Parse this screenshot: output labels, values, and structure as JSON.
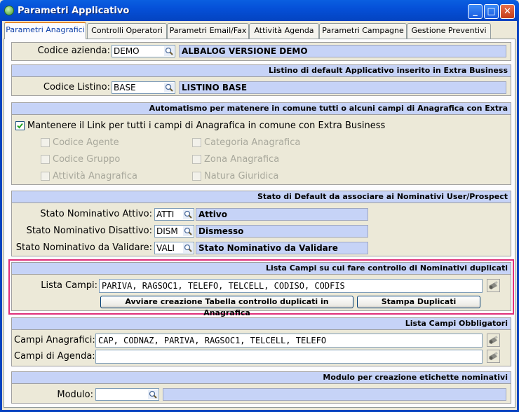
{
  "window": {
    "title": "Parametri Applicativo",
    "min": "_",
    "max": "□",
    "close": "✕"
  },
  "tabs": [
    "Parametri Anagrafici",
    "Controlli Operatori",
    "Parametri Email/Fax",
    "Attività Agenda",
    "Parametri Campagne",
    "Gestione Preventivi"
  ],
  "azienda": {
    "label": "Codice azienda:",
    "code": "DEMO",
    "desc": "ALBALOG VERSIONE DEMO"
  },
  "listino": {
    "header": "Listino di default Applicativo inserito in Extra Business",
    "label": "Codice Listino:",
    "code": "BASE",
    "desc": "LISTINO BASE"
  },
  "automatismo": {
    "header": "Automatismo per matenere in comune tutti o alcuni campi di Anagrafica con Extra",
    "main_label": "Mantenere il Link per tutti i campi di Anagrafica in comune con Extra Business",
    "main_checked": true,
    "options": [
      "Codice Agente",
      "Categoria Anagrafica",
      "Codice Gruppo",
      "Zona Anagrafica",
      "Attività Anagrafica",
      "Natura Giuridica"
    ]
  },
  "stato": {
    "header": "Stato di Default da associare ai Nominativi User/Prospect",
    "rows": [
      {
        "label": "Stato Nominativo Attivo:",
        "code": "ATTI",
        "desc": "Attivo"
      },
      {
        "label": "Stato Nominativo Disattivo:",
        "code": "DISM",
        "desc": "Dismesso"
      },
      {
        "label": "Stato Nominativo da Validare:",
        "code": "VALI",
        "desc": "Stato Nominativo da Validare"
      }
    ]
  },
  "duplicati": {
    "header": "Lista Campi su cui fare controllo di Nominativi duplicati",
    "label": "Lista Campi:",
    "value": "PARIVA, RAGSOC1, TELEFO, TELCELL, CODISO, CODFIS",
    "btn_create": "Avviare creazione Tabella controllo duplicati  in Anagrafica",
    "btn_print": "Stampa Duplicati"
  },
  "obbligatori": {
    "header": "Lista Campi Obbligatori",
    "anag_label": "Campi Anagrafici:",
    "anag_value": "CAP, CODNAZ, PARIVA, RAGSOC1, TELCELL, TELEFO",
    "agenda_label": "Campi di Agenda:",
    "agenda_value": ""
  },
  "modulo": {
    "header": "Modulo per creazione etichette nominativi",
    "label": "Modulo:",
    "code": "",
    "desc": ""
  },
  "colors": {
    "title_bar": "#0550d8",
    "group_header": "#c6d3f7",
    "highlight": "#e0307a",
    "window_bg": "#ece9d8"
  }
}
